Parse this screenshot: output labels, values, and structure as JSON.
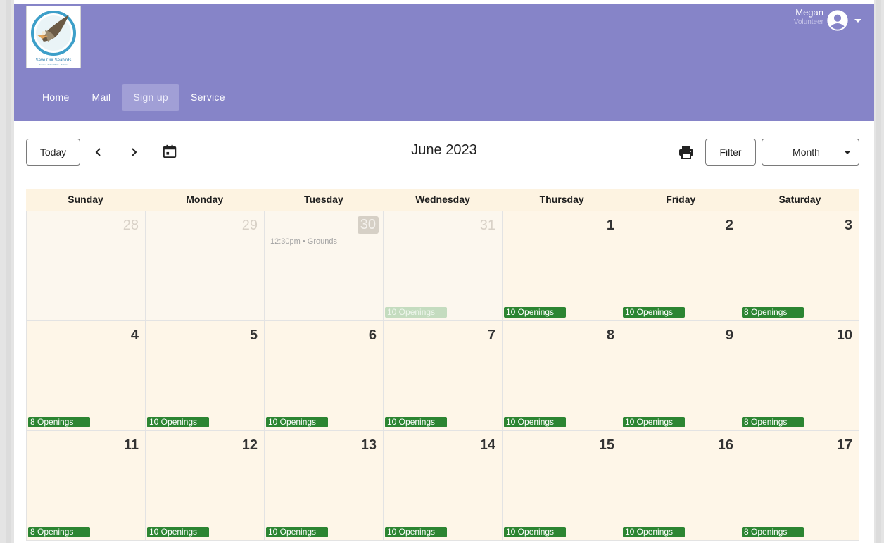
{
  "logo": {
    "title": "Save Our Seabirds",
    "tagline": "Rescue · Rehabilitate · Release"
  },
  "user": {
    "name": "Megan",
    "role": "Volunteer"
  },
  "nav": [
    {
      "label": "Home",
      "active": false
    },
    {
      "label": "Mail",
      "active": false
    },
    {
      "label": "Sign up",
      "active": true
    },
    {
      "label": "Service",
      "active": false
    }
  ],
  "toolbar": {
    "today_label": "Today",
    "title": "June 2023",
    "filter_label": "Filter",
    "view_select": "Month"
  },
  "calendar": {
    "weekdays": [
      "Sunday",
      "Monday",
      "Tuesday",
      "Wednesday",
      "Thursday",
      "Friday",
      "Saturday"
    ],
    "weeks": [
      [
        {
          "day": "28",
          "other": true
        },
        {
          "day": "29",
          "other": true
        },
        {
          "day": "30",
          "other": true,
          "highlight": true,
          "event": "12:30pm • Grounds"
        },
        {
          "day": "31",
          "other": true,
          "openings": "10 Openings",
          "faded": true
        },
        {
          "day": "1",
          "openings": "10 Openings"
        },
        {
          "day": "2",
          "openings": "10 Openings"
        },
        {
          "day": "3",
          "openings": "8 Openings"
        }
      ],
      [
        {
          "day": "4",
          "openings": "8 Openings"
        },
        {
          "day": "5",
          "openings": "10 Openings"
        },
        {
          "day": "6",
          "openings": "10 Openings"
        },
        {
          "day": "7",
          "openings": "10 Openings"
        },
        {
          "day": "8",
          "openings": "10 Openings"
        },
        {
          "day": "9",
          "openings": "10 Openings"
        },
        {
          "day": "10",
          "openings": "8 Openings"
        }
      ],
      [
        {
          "day": "11",
          "openings": "8 Openings"
        },
        {
          "day": "12",
          "openings": "10 Openings"
        },
        {
          "day": "13",
          "openings": "10 Openings"
        },
        {
          "day": "14",
          "openings": "10 Openings"
        },
        {
          "day": "15",
          "openings": "10 Openings"
        },
        {
          "day": "16",
          "openings": "10 Openings"
        },
        {
          "day": "17",
          "openings": "8 Openings"
        }
      ]
    ]
  },
  "colors": {
    "header": "#8684c8",
    "nav_active": "#a19fd6",
    "cell_bg": "#fef6e8",
    "openings_badge": "#2c8532"
  }
}
